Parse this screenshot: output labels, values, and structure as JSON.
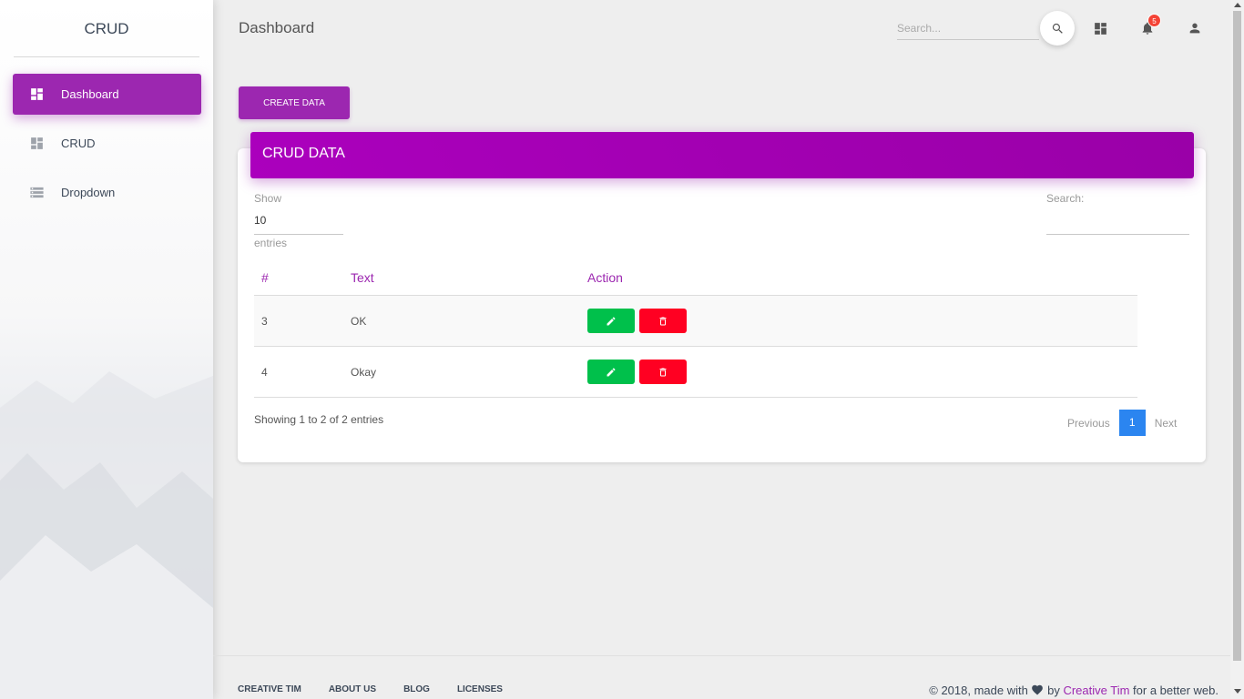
{
  "sidebar": {
    "brand": "CRUD",
    "items": [
      {
        "label": "Dashboard",
        "icon": "dashboard-icon",
        "active": true
      },
      {
        "label": "CRUD",
        "icon": "dashboard-icon",
        "active": false
      },
      {
        "label": "Dropdown",
        "icon": "storage-icon",
        "active": false
      }
    ]
  },
  "header": {
    "title": "Dashboard",
    "search_placeholder": "Search...",
    "notification_count": "5"
  },
  "toolbar": {
    "create_label": "CREATE DATA"
  },
  "card": {
    "title": "CRUD DATA",
    "show_label": "Show",
    "page_size": "10",
    "entries_label": "entries",
    "search_label": "Search:",
    "columns": [
      "#",
      "Text",
      "Action"
    ],
    "rows": [
      {
        "id": "3",
        "text": "OK"
      },
      {
        "id": "4",
        "text": "Okay"
      }
    ],
    "info": "Showing 1 to 2 of 2 entries",
    "pager": {
      "prev": "Previous",
      "current": "1",
      "next": "Next"
    }
  },
  "footer": {
    "links": [
      "CREATIVE TIM",
      "ABOUT US",
      "BLOG",
      "LICENSES"
    ],
    "copyright_prefix": "© 2018, made with",
    "copyright_by": "by",
    "copyright_link": "Creative Tim",
    "copyright_suffix": "for a better web."
  },
  "colors": {
    "primary": "#9c27b0",
    "success": "#00c04b",
    "danger": "#ff0022",
    "info": "#2b85f0",
    "badge": "#f44336"
  }
}
